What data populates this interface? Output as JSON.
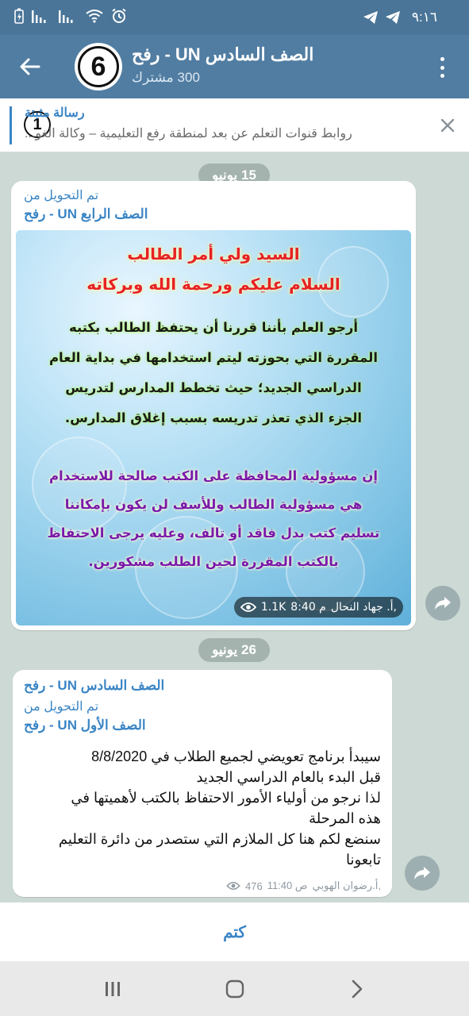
{
  "status_bar": {
    "time": "٩:١٦",
    "icons": [
      "telegram-icon",
      "telegram-icon",
      "alarm-icon",
      "wifi-icon",
      "signal-icon",
      "signal-icon",
      "battery-icon"
    ]
  },
  "header": {
    "title": "الصف السادس UN - رفح",
    "subtitle": "300 مشترك",
    "avatar_text": "6"
  },
  "pinned": {
    "title": "رسالة مثبتة",
    "text": "روابط قنوات التعلم عن بعد لمنطقة رفع التعليمية – وكالة الغو...",
    "badge": "1"
  },
  "messages": [
    {
      "date": "15 يونيو",
      "forwarded_label": "تم التحويل من",
      "forwarded_from": "الصف الرابع UN - رفح",
      "image_lines": {
        "greeting1": "السيد ولي أمر الطالب",
        "greeting2": "السلام عليكم ورحمة الله وبركاته",
        "para1_l1": "أرجو العلم بأننا قررنا أن يحتفظ الطالب بكتبه",
        "para1_l2": "المقررة التي بحوزته ليتم استخدامها في بداية العام",
        "para1_l3": "الدراسي الجديد؛ حيث تخطط المدارس لتدريس",
        "para1_l4": "الجزء الذي تعذر تدريسه بسبب إغلاق المدارس.",
        "para2_l1": "إن مسؤولية المحافظة على الكتب صالحة للاستخدام",
        "para2_l2": "هي مسؤولية الطالب وللأسف لن يكون بإمكاننا",
        "para2_l3": "تسليم كتب بدل فاقد أو تالف، وعليه يرجى الاحتفاظ",
        "para2_l4": "بالكتب المقررة لحين الطلب مشكورين."
      },
      "author": "أ. جهاد النحال,",
      "time": "8:40 م",
      "views": "1.1K"
    },
    {
      "date": "26 يونيو",
      "channel": "الصف السادس UN - رفح",
      "forwarded_label": "تم التحويل من",
      "forwarded_from": "الصف الأول UN - رفح",
      "text_lines": [
        "سيبدأ برنامج تعويضي لجميع الطلاب في 8/8/2020",
        "قبل البدء بالعام الدراسي الجديد",
        "لذا نرجو من أولياء الأمور الاحتفاظ بالكتب لأهميتها في",
        "هذه المرحلة",
        "سنضع لكم هنا كل الملازم التي ستصدر من دائرة التعليم",
        "تابعونا"
      ],
      "author": "أ.رضوان الهوبي,",
      "time": "11:40 ص",
      "views": "476"
    }
  ],
  "bottom": {
    "mute_label": "كتم"
  },
  "colors": {
    "header": "#517da2",
    "status_bar": "#4a7598",
    "accent": "#3a85c5",
    "chat_bg": "#cdd9d4"
  }
}
